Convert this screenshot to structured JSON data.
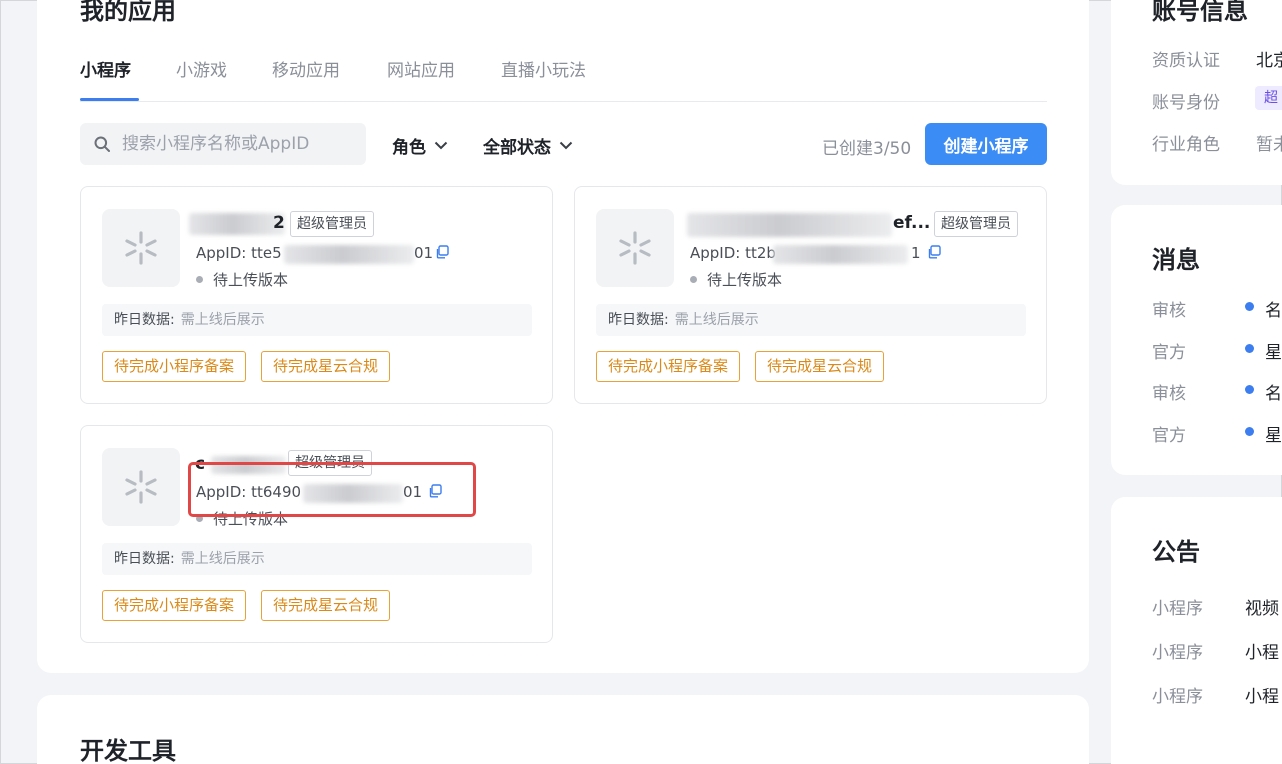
{
  "my_apps": {
    "title": "我的应用",
    "tabs": [
      {
        "label": "小程序",
        "active": true
      },
      {
        "label": "小游戏",
        "active": false
      },
      {
        "label": "移动应用",
        "active": false
      },
      {
        "label": "网站应用",
        "active": false
      },
      {
        "label": "直播小玩法",
        "active": false
      }
    ],
    "search": {
      "placeholder": "搜索小程序名称或AppID"
    },
    "filters": {
      "role": "角色",
      "status": "全部状态"
    },
    "count_text": "已创建3/50",
    "create_button": "创建小程序",
    "apps": [
      {
        "name_visible": "2",
        "role": "超级管理员",
        "appid_prefix": "AppID: tte5",
        "appid_suffix": "01",
        "status": "待上传版本",
        "yesterday_label": "昨日数据:",
        "yesterday_value": "需上线后展示",
        "tags": [
          "待完成小程序备案",
          "待完成星云合规"
        ]
      },
      {
        "name_visible": "ef...",
        "role": "超级管理员",
        "appid_prefix": "AppID: tt2b",
        "appid_suffix": "1",
        "status": "待上传版本",
        "yesterday_label": "昨日数据:",
        "yesterday_value": "需上线后展示",
        "tags": [
          "待完成小程序备案",
          "待完成星云合规"
        ]
      },
      {
        "name_visible": "c",
        "role": "超级管理员",
        "appid_prefix": "AppID: tt6490",
        "appid_suffix": "01",
        "status": "待上传版本",
        "yesterday_label": "昨日数据:",
        "yesterday_value": "需上线后展示",
        "tags": [
          "待完成小程序备案",
          "待完成星云合规"
        ]
      }
    ]
  },
  "dev_tools": {
    "title": "开发工具"
  },
  "account": {
    "title": "账号信息",
    "rows": [
      {
        "label": "资质认证",
        "value": "北京"
      },
      {
        "label": "账号身份",
        "value": "超"
      },
      {
        "label": "行业角色",
        "value": "暂未"
      }
    ]
  },
  "messages": {
    "title": "消息",
    "rows": [
      {
        "label": "审核",
        "value": "名"
      },
      {
        "label": "官方",
        "value": "星"
      },
      {
        "label": "审核",
        "value": "名"
      },
      {
        "label": "官方",
        "value": "星"
      }
    ]
  },
  "notices": {
    "title": "公告",
    "rows": [
      {
        "label": "小程序",
        "value": "视频"
      },
      {
        "label": "小程序",
        "value": "小程"
      },
      {
        "label": "小程序",
        "value": "小程"
      }
    ]
  },
  "colors": {
    "accent": "#3c8cf5",
    "tag": "#e8a23a",
    "highlight": "#e04848",
    "role_chip": "#6b4fe6"
  }
}
